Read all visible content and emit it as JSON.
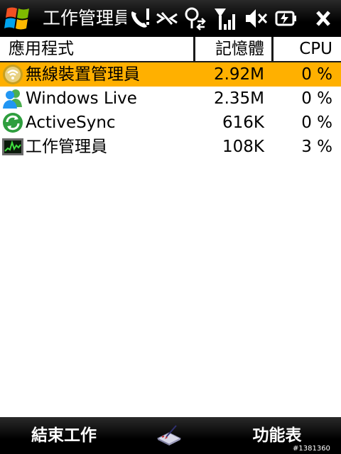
{
  "titlebar": {
    "title": "工作管理員",
    "start_icon": "windows-flag-icon",
    "status_icons": [
      "phone-alert-icon",
      "wifi-disconnected-icon",
      "data-connection-icon",
      "signal-strength-icon",
      "volume-muted-icon",
      "battery-charging-icon"
    ],
    "close_label": "✕"
  },
  "columns": {
    "app": "應用程式",
    "memory": "記憶體",
    "cpu": "CPU"
  },
  "processes": [
    {
      "name": "無線裝置管理員",
      "memory": "2.92M",
      "cpu": "0 %",
      "icon": "wireless-manager-icon",
      "selected": true
    },
    {
      "name": "Windows Live",
      "memory": "2.35M",
      "cpu": "0 %",
      "icon": "windows-live-icon",
      "selected": false
    },
    {
      "name": "ActiveSync",
      "memory": "616K",
      "cpu": "0 %",
      "icon": "activesync-icon",
      "selected": false
    },
    {
      "name": "工作管理員",
      "memory": "108K",
      "cpu": "3 %",
      "icon": "task-manager-icon",
      "selected": false
    }
  ],
  "softkeys": {
    "left": "結束工作",
    "right": "功能表",
    "center_icon": "input-panel-icon"
  },
  "tag": "#1381360",
  "colors": {
    "selected_row": "#ffb000",
    "bar_background": "#000000"
  }
}
